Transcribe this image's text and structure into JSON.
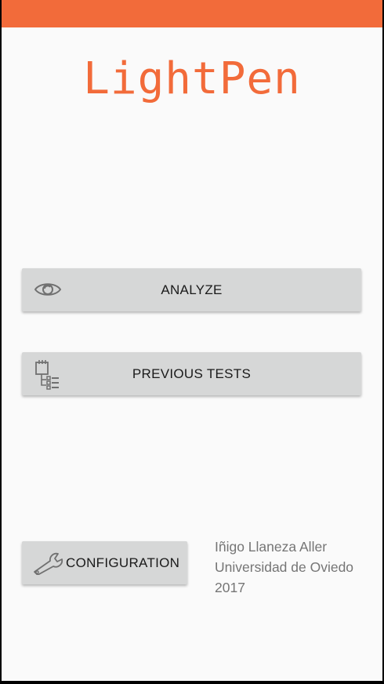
{
  "app": {
    "title": "LightPen",
    "accent_color": "#f26b3a"
  },
  "buttons": {
    "analyze": {
      "label": "ANALYZE",
      "icon": "eye-icon"
    },
    "previous_tests": {
      "label": "PREVIOUS TESTS",
      "icon": "test-list-icon"
    },
    "configuration": {
      "label": "CONFIGURATION",
      "icon": "wrench-icon"
    }
  },
  "credits": {
    "author": "Iñigo Llaneza Aller",
    "university": "Universidad de Oviedo",
    "year": "2017"
  }
}
